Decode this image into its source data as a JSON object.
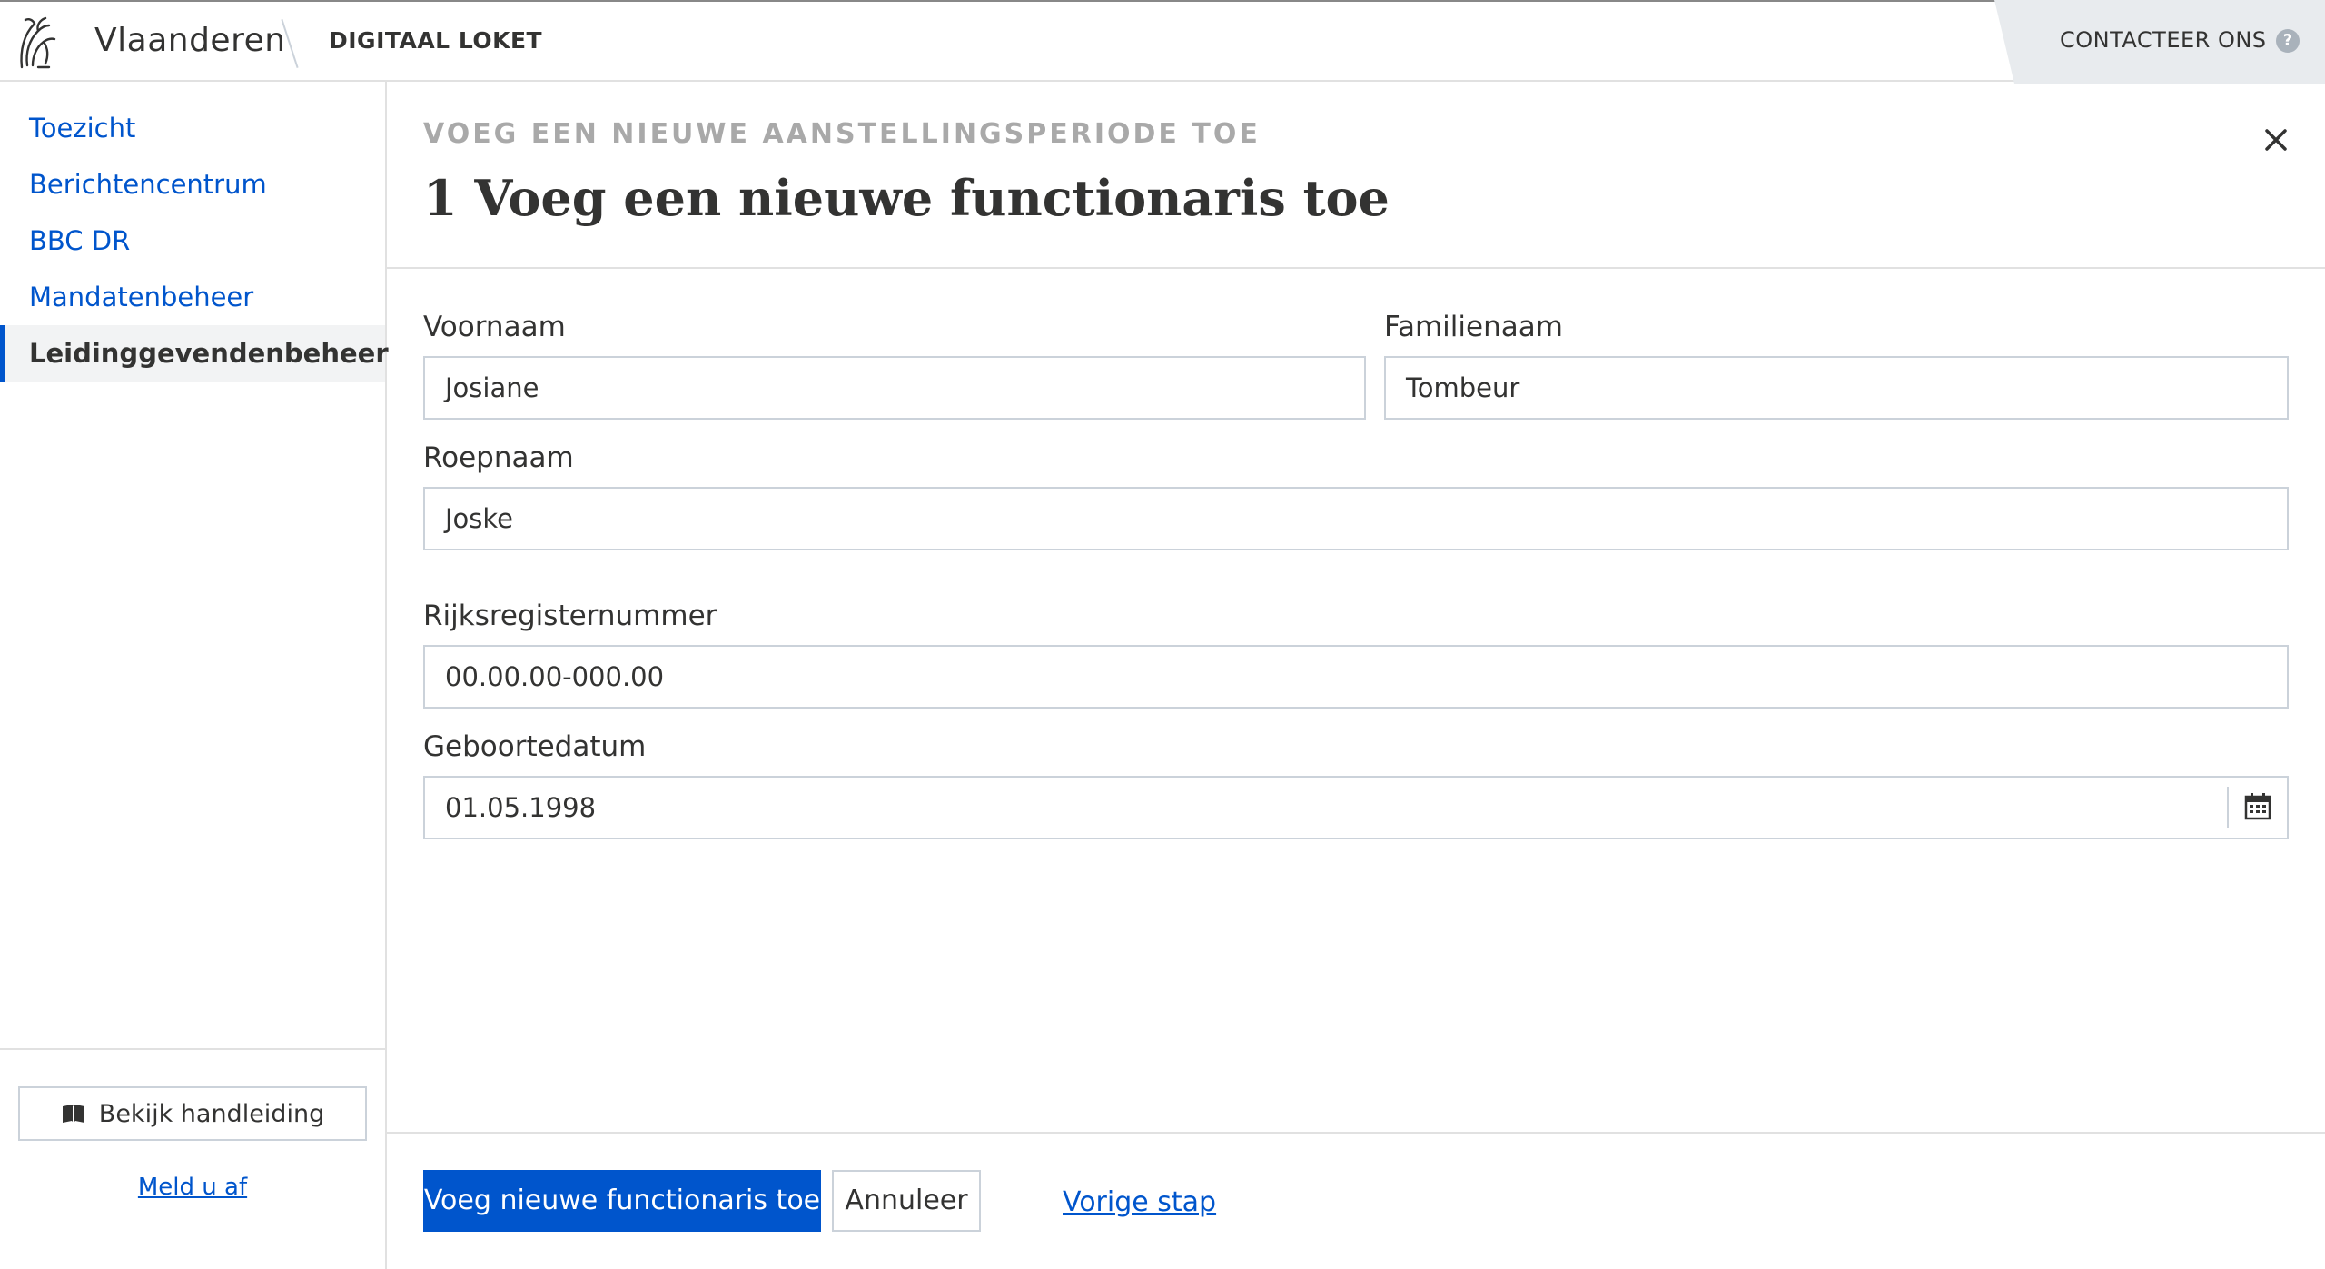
{
  "header": {
    "brand": "Vlaanderen",
    "app_name": "DIGITAAL LOKET",
    "contact_label": "CONTACTEER ONS",
    "help_glyph": "?"
  },
  "sidebar": {
    "items": [
      {
        "label": "Toezicht"
      },
      {
        "label": "Berichtencentrum"
      },
      {
        "label": "BBC DR"
      },
      {
        "label": "Mandatenbeheer"
      },
      {
        "label": "Leidinggevendenbeheer",
        "active": true
      }
    ],
    "manual_button": "Bekijk handleiding",
    "logout_link": "Meld u af"
  },
  "modal": {
    "eyebrow": "VOEG EEN NIEUWE AANSTELLINGSPERIODE TOE",
    "title": "1 Voeg een nieuwe functionaris toe",
    "fields": {
      "first_name": {
        "label": "Voornaam",
        "value": "Josiane"
      },
      "last_name": {
        "label": "Familienaam",
        "value": "Tombeur"
      },
      "nickname": {
        "label": "Roepnaam",
        "value": "Joske"
      },
      "national_id": {
        "label": "Rijksregisternummer",
        "value": "00.00.00-000.00"
      },
      "birth_date": {
        "label": "Geboortedatum",
        "value": "01.05.1998"
      }
    },
    "actions": {
      "primary": "Voeg nieuwe functionaris toe",
      "cancel": "Annuleer",
      "previous": "Vorige stap"
    }
  },
  "icons": {
    "logo": "flemish-lion-icon",
    "close": "close-icon",
    "calendar": "calendar-icon",
    "book": "book-icon",
    "help": "help-icon"
  },
  "colors": {
    "link_blue": "#0055cc",
    "text": "#333332",
    "eyebrow_gray": "#a9a9a9",
    "border": "#cbd2da",
    "contact_bg": "#e8ebee"
  }
}
